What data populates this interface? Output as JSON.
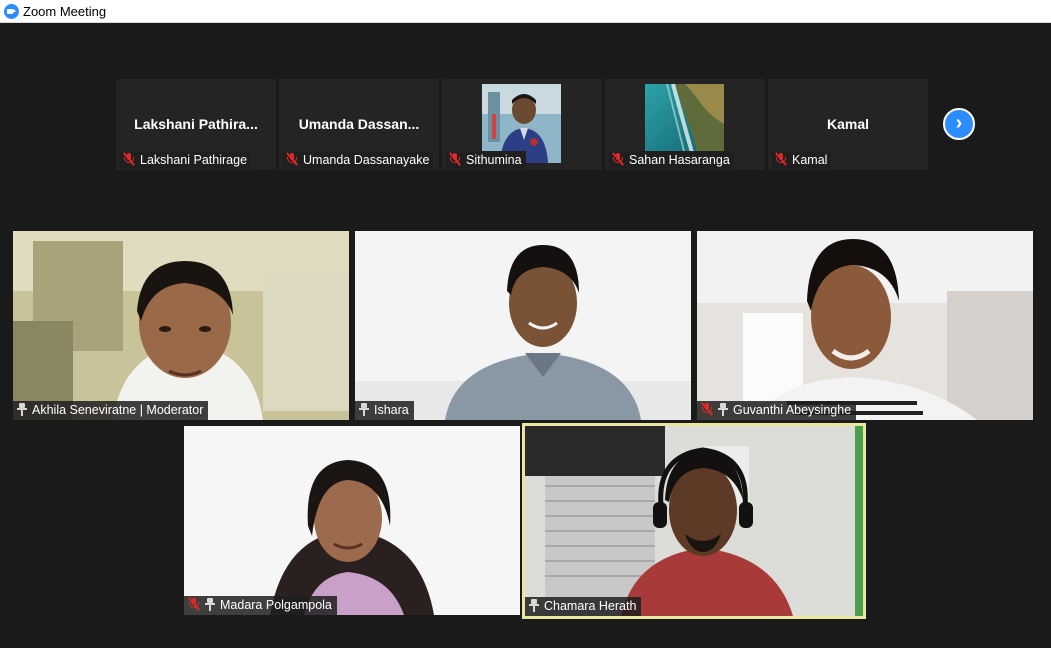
{
  "window": {
    "title": "Zoom Meeting"
  },
  "thumbnails": [
    {
      "display_name": "Lakshani  Pathira...",
      "label": "Lakshani Pathirage",
      "muted": true,
      "has_image": false
    },
    {
      "display_name": "Umanda  Dassan...",
      "label": "Umanda Dassanayake",
      "muted": true,
      "has_image": false
    },
    {
      "display_name": "",
      "label": "Sithumina",
      "muted": true,
      "has_image": true
    },
    {
      "display_name": "",
      "label": "Sahan Hasaranga",
      "muted": true,
      "has_image": true
    },
    {
      "display_name": "Kamal",
      "label": "Kamal",
      "muted": true,
      "has_image": false
    }
  ],
  "next_page": {
    "icon": "chevron-right-icon",
    "glyph": "›"
  },
  "videos": [
    {
      "label": "Akhila Seneviratne | Moderator",
      "muted": false,
      "pinned": true
    },
    {
      "label": "Ishara",
      "muted": false,
      "pinned": true
    },
    {
      "label": "Guvanthi Abeysinghe",
      "muted": true,
      "pinned": true
    },
    {
      "label": "Madara Polgampola",
      "muted": true,
      "pinned": true
    },
    {
      "label": "Chamara Herath",
      "muted": false,
      "pinned": true,
      "active_speaker": true
    }
  ],
  "colors": {
    "accent": "#2d8cff",
    "muted_icon": "#e02828",
    "active_speaker_border": "#e8e6a0",
    "background": "#1a1a1a"
  }
}
